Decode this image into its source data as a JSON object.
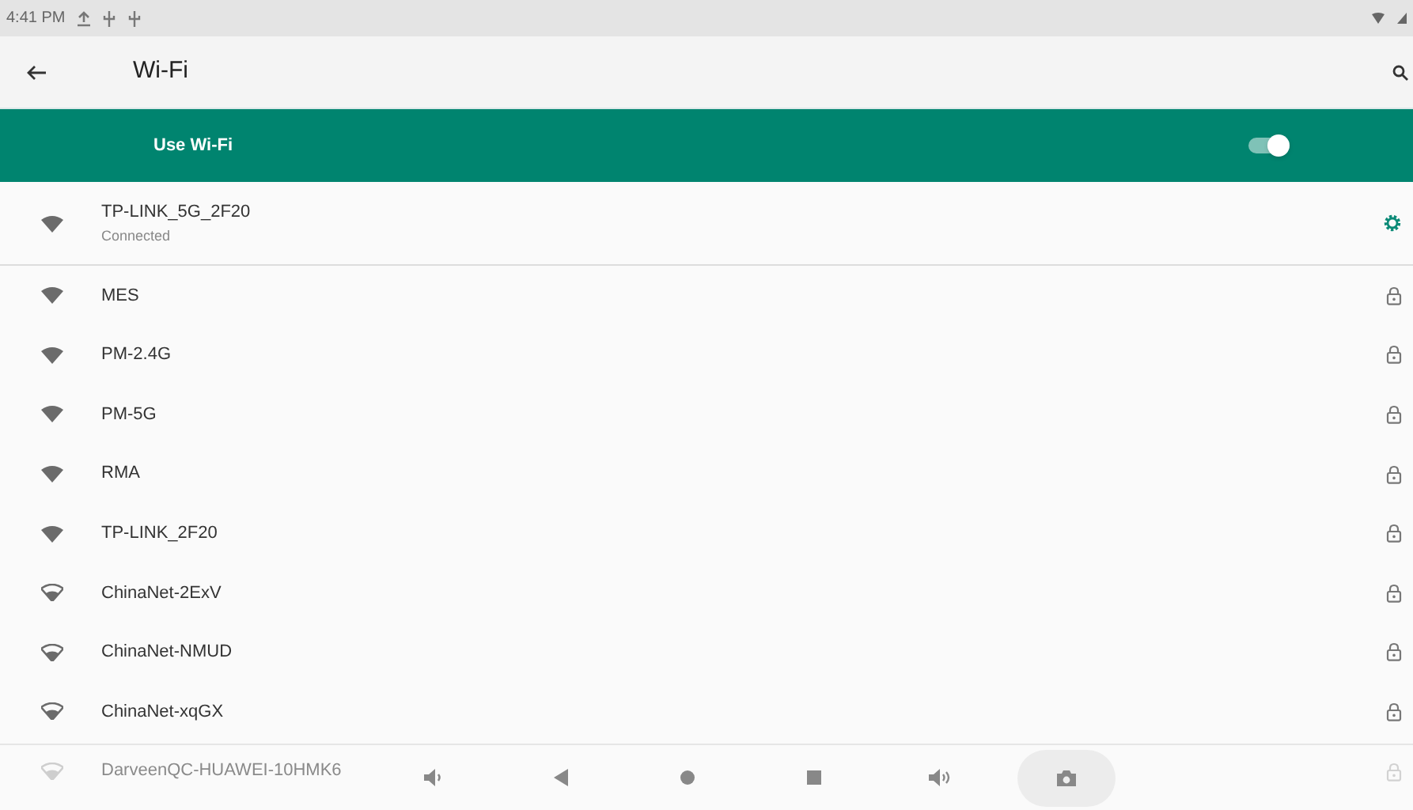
{
  "status_bar": {
    "time": "4:41 PM"
  },
  "toolbar": {
    "title": "Wi-Fi"
  },
  "master_switch": {
    "label": "Use Wi-Fi",
    "on": true
  },
  "networks": [
    {
      "name": "TP-LINK_5G_2F20",
      "status": "Connected",
      "kind": "strong",
      "connected": true
    },
    {
      "name": "MES",
      "kind": "strong",
      "secured": true,
      "connected": false
    },
    {
      "name": "PM-2.4G",
      "kind": "strong",
      "secured": true,
      "connected": false
    },
    {
      "name": "PM-5G",
      "kind": "strong",
      "secured": true,
      "connected": false
    },
    {
      "name": "RMA",
      "kind": "strong",
      "secured": true,
      "connected": false
    },
    {
      "name": "TP-LINK_2F20",
      "kind": "strong",
      "secured": true,
      "connected": false
    },
    {
      "name": "ChinaNet-2ExV",
      "kind": "weak",
      "secured": true,
      "connected": false
    },
    {
      "name": "ChinaNet-NMUD",
      "kind": "weak",
      "secured": true,
      "connected": false
    },
    {
      "name": "ChinaNet-xqGX",
      "kind": "weak",
      "secured": true,
      "connected": false
    },
    {
      "name": "DarveenQC-HUAWEI-10HMK6",
      "kind": "weak",
      "secured": true,
      "connected": false,
      "faded": true
    }
  ],
  "nav_bar": [
    {
      "kind": "volume-down"
    },
    {
      "kind": "back"
    },
    {
      "kind": "home"
    },
    {
      "kind": "recents"
    },
    {
      "kind": "volume-up"
    },
    {
      "kind": "screenshot"
    }
  ]
}
